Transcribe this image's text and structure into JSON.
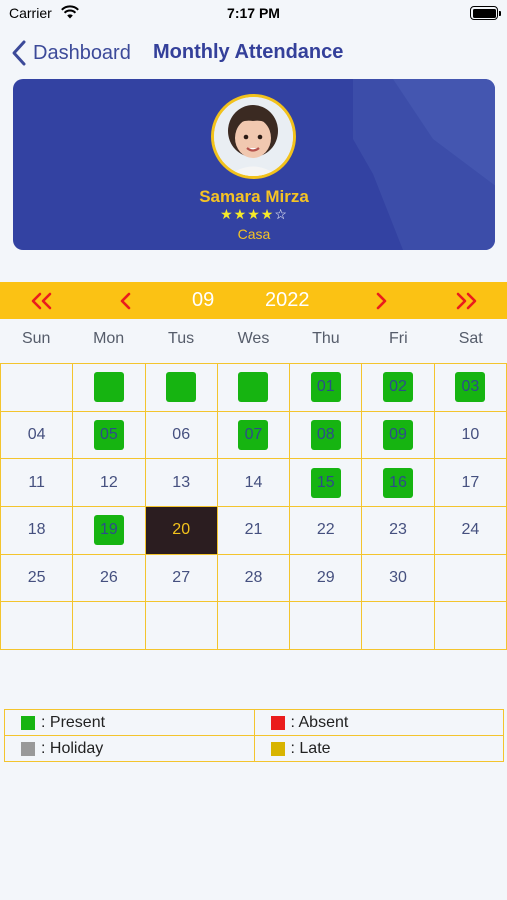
{
  "status_bar": {
    "carrier": "Carrier",
    "time": "7:17 PM"
  },
  "nav": {
    "back_label": "Dashboard",
    "title": "Monthly Attendance"
  },
  "profile": {
    "name": "Samara Mirza",
    "stars_filled": "★★★★",
    "stars_empty": "☆",
    "rating": 4,
    "rating_max": 5,
    "location": "Casa"
  },
  "calendar": {
    "month": "09",
    "year": "2022",
    "weekdays": [
      "Sun",
      "Mon",
      "Tus",
      "Wes",
      "Thu",
      "Fri",
      "Sat"
    ],
    "cells": [
      "",
      "",
      "",
      "",
      "01",
      "02",
      "03",
      "04",
      "05",
      "06",
      "07",
      "08",
      "09",
      "10",
      "11",
      "12",
      "13",
      "14",
      "15",
      "16",
      "17",
      "18",
      "19",
      "20",
      "21",
      "22",
      "23",
      "24",
      "25",
      "26",
      "27",
      "28",
      "29",
      "30",
      "",
      "",
      "",
      "",
      "",
      "",
      "",
      ""
    ],
    "present_cells": [
      1,
      2,
      3,
      4,
      5,
      6,
      8,
      10,
      11,
      12,
      18,
      19,
      22
    ],
    "today_cell": 23
  },
  "legend": [
    {
      "label": ": Present",
      "color": "#16b411"
    },
    {
      "label": ": Absent",
      "color": "#ea1c1c"
    },
    {
      "label": ": Holiday",
      "color": "#999999"
    },
    {
      "label": ": Late",
      "color": "#d8b400"
    }
  ]
}
